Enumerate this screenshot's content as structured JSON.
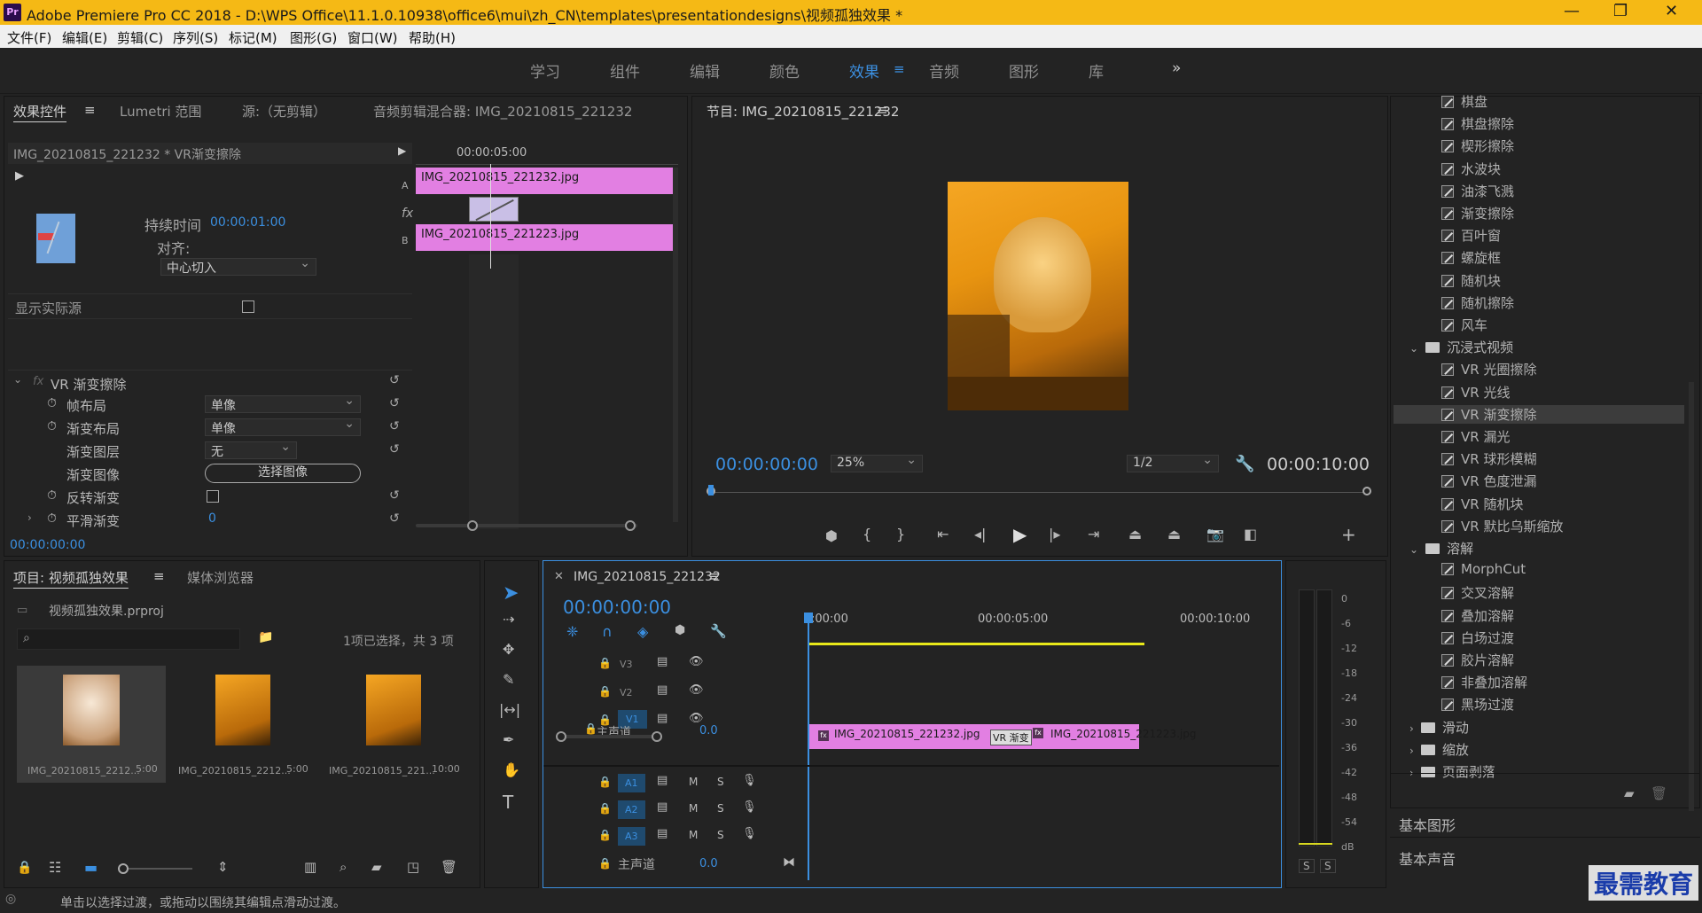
{
  "app": {
    "title": "Adobe Premiere Pro CC 2018 - D:\\WPS Office\\11.1.0.10938\\office6\\mui\\zh_CN\\templates\\presentationdesigns\\视频孤独效果 *",
    "logo": "Pr"
  },
  "menu": [
    "文件(F)",
    "编辑(E)",
    "剪辑(C)",
    "序列(S)",
    "标记(M)",
    "图形(G)",
    "窗口(W)",
    "帮助(H)"
  ],
  "workspaces": [
    "学习",
    "组件",
    "编辑",
    "颜色",
    "效果",
    "音频",
    "图形",
    "库"
  ],
  "active_workspace": "效果",
  "effect_controls": {
    "tabs": [
      "效果控件",
      "Lumetri 范围",
      "源:（无剪辑）",
      "音频剪辑混合器: IMG_20210815_221232"
    ],
    "clip_name": "IMG_20210815_221232 * VR渐变擦除",
    "timecode_top": "00:00:05:00",
    "clip_a": "IMG_20210815_221232.jpg",
    "clip_b": "IMG_20210815_221223.jpg",
    "label_a": "A",
    "label_b": "B",
    "fx_label": "fx",
    "duration_label": "持续时间",
    "duration_value": "00:00:01:00",
    "align_label": "对齐:",
    "align_value": "中心切入",
    "show_actual_label": "显示实际源",
    "effect_name": "VR 渐变擦除",
    "props": [
      {
        "name": "帧布局",
        "value": "单像"
      },
      {
        "name": "渐变布局",
        "value": "单像"
      },
      {
        "name": "渐变图层",
        "value": "无"
      },
      {
        "name": "渐变图像",
        "value": "选择图像"
      },
      {
        "name": "反转渐变",
        "value": ""
      },
      {
        "name": "平滑渐变",
        "value": "0"
      }
    ],
    "bottom_timecode": "00:00:00:00"
  },
  "program": {
    "title": "节目: IMG_20210815_221232",
    "timecode": "00:00:00:00",
    "zoom": "25%",
    "resolution": "1/2",
    "duration": "00:00:10:00"
  },
  "effects_list": {
    "items": [
      {
        "type": "item",
        "label": "棋盘"
      },
      {
        "type": "item",
        "label": "棋盘擦除"
      },
      {
        "type": "item",
        "label": "楔形擦除"
      },
      {
        "type": "item",
        "label": "水波块"
      },
      {
        "type": "item",
        "label": "油漆飞溅"
      },
      {
        "type": "item",
        "label": "渐变擦除"
      },
      {
        "type": "item",
        "label": "百叶窗"
      },
      {
        "type": "item",
        "label": "螺旋框"
      },
      {
        "type": "item",
        "label": "随机块"
      },
      {
        "type": "item",
        "label": "随机擦除"
      },
      {
        "type": "item",
        "label": "风车"
      },
      {
        "type": "folder",
        "label": "沉浸式视频",
        "open": true
      },
      {
        "type": "item",
        "label": "VR 光圈擦除"
      },
      {
        "type": "item",
        "label": "VR 光线"
      },
      {
        "type": "item",
        "label": "VR 渐变擦除",
        "selected": true
      },
      {
        "type": "item",
        "label": "VR 漏光"
      },
      {
        "type": "item",
        "label": "VR 球形模糊"
      },
      {
        "type": "item",
        "label": "VR 色度泄漏"
      },
      {
        "type": "item",
        "label": "VR 随机块"
      },
      {
        "type": "item",
        "label": "VR 默比乌斯缩放"
      },
      {
        "type": "folder",
        "label": "溶解",
        "open": true
      },
      {
        "type": "item",
        "label": "MorphCut"
      },
      {
        "type": "item",
        "label": "交叉溶解"
      },
      {
        "type": "item",
        "label": "叠加溶解"
      },
      {
        "type": "item",
        "label": "白场过渡"
      },
      {
        "type": "item",
        "label": "胶片溶解"
      },
      {
        "type": "item",
        "label": "非叠加溶解"
      },
      {
        "type": "item",
        "label": "黑场过渡"
      },
      {
        "type": "folder",
        "label": "滑动",
        "open": false
      },
      {
        "type": "folder",
        "label": "缩放",
        "open": false
      },
      {
        "type": "folder",
        "label": "页面剥落",
        "open": false
      }
    ],
    "bottom_panels": [
      "基本图形",
      "基本声音"
    ]
  },
  "project": {
    "tabs": [
      "项目: 视频孤独效果",
      "媒体浏览器"
    ],
    "file": "视频孤独效果.prproj",
    "selection": "1项已选择，共 3 项",
    "thumbs": [
      {
        "name": "IMG_20210815_2212...",
        "dur": "5:00"
      },
      {
        "name": "IMG_20210815_2212...",
        "dur": "5:00"
      },
      {
        "name": "IMG_20210815_221...",
        "dur": "10:00"
      }
    ]
  },
  "timeline": {
    "title": "IMG_20210815_221232",
    "timecode": "00:00:00:00",
    "ruler": [
      ":00:00",
      "00:00:05:00",
      "00:00:10:00"
    ],
    "video_tracks": [
      "V3",
      "V2",
      "V1"
    ],
    "audio_tracks": [
      "A1",
      "A2",
      "A3"
    ],
    "master": "主声道",
    "master_value": "0.0",
    "m_label": "M",
    "s_label": "S",
    "clip1": "IMG_20210815_221232.jpg",
    "clip2": "IMG_20210815_221223.jpg",
    "transition": "VR 渐变"
  },
  "audio_meter": {
    "scale": [
      "0",
      "-6",
      "-12",
      "-18",
      "-24",
      "-30",
      "-36",
      "-42",
      "-48",
      "-54",
      "dB"
    ],
    "solo": [
      "S",
      "S"
    ]
  },
  "status": "单击以选择过渡，或拖动以围绕其编辑点滑动过渡。",
  "watermark": "最需教育",
  "colors": {
    "accent": "#3b8fe0",
    "clip": "#e27fe2",
    "titlebar": "#f5b915"
  }
}
